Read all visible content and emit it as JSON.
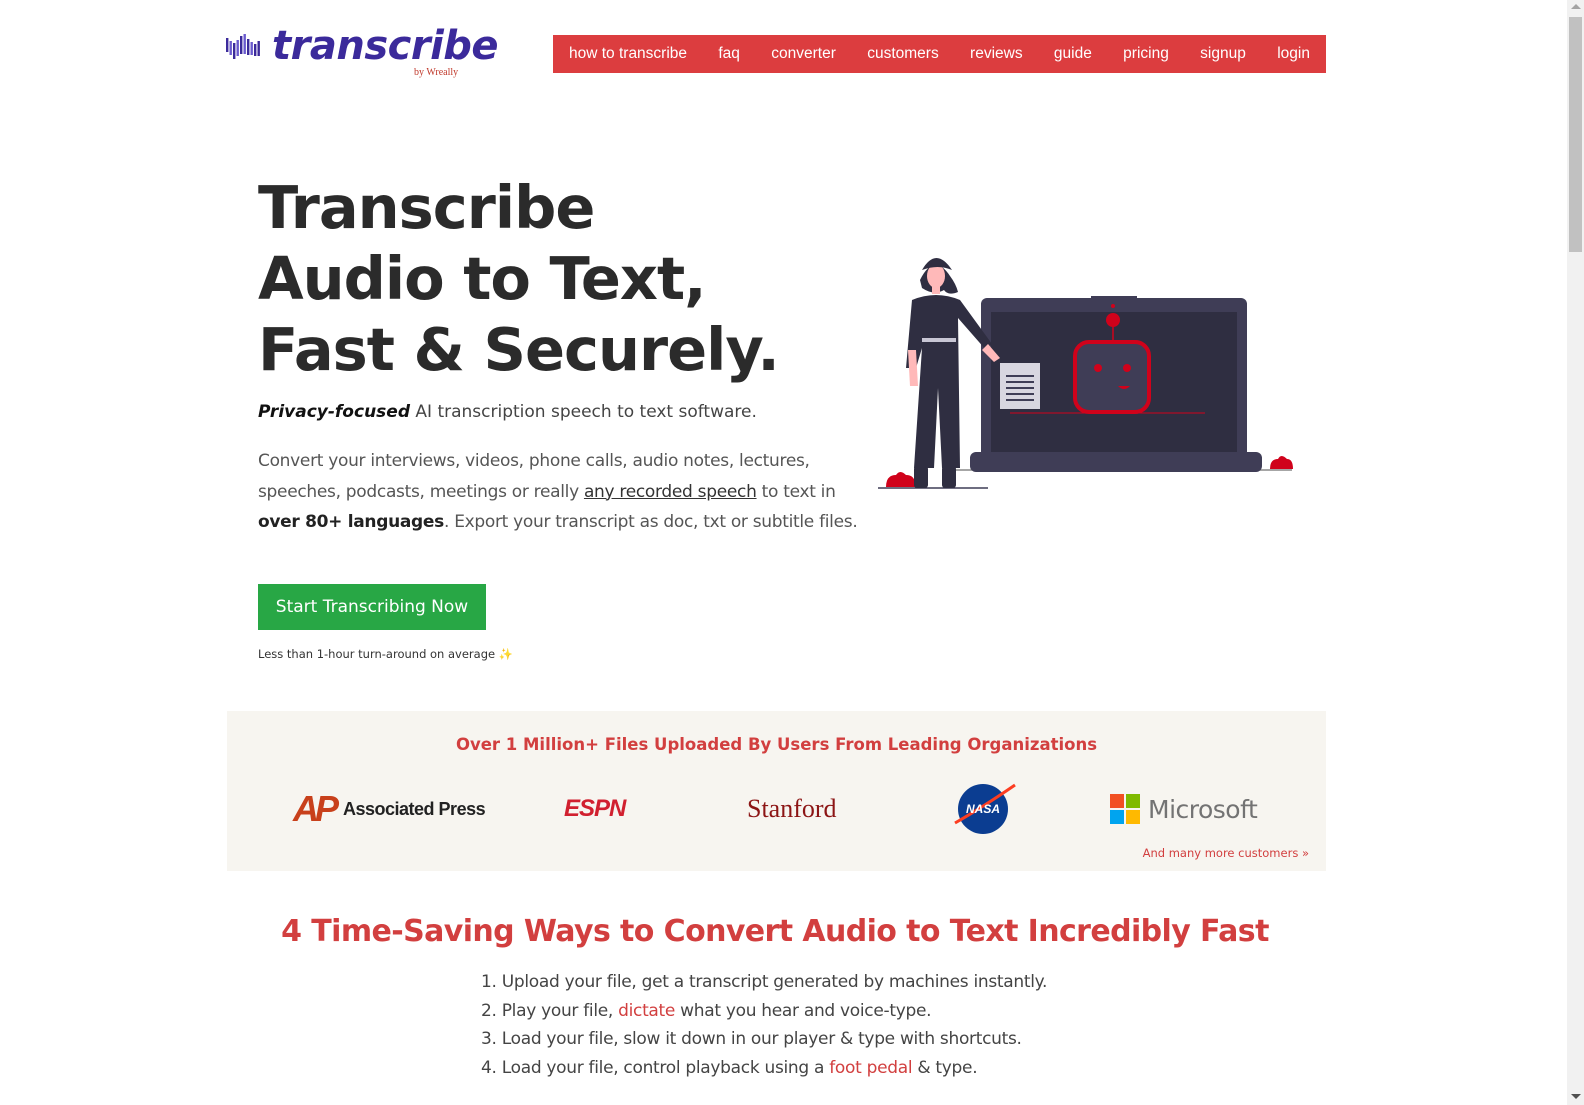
{
  "brand": {
    "name": "transcribe",
    "byline": "by Wreally",
    "color": "#3b2a9b",
    "logo_icon": "sound-wave-icon"
  },
  "nav": {
    "color": "#dc3d3f",
    "items": [
      {
        "label": "how to transcribe"
      },
      {
        "label": "faq"
      },
      {
        "label": "converter"
      },
      {
        "label": "customers"
      },
      {
        "label": "reviews"
      },
      {
        "label": "guide"
      },
      {
        "label": "pricing"
      },
      {
        "label": "signup"
      },
      {
        "label": "login"
      }
    ]
  },
  "hero": {
    "title_lines": [
      "Transcribe",
      "Audio to Text,",
      "Fast & Securely."
    ],
    "tagline_emphasis": "Privacy-focused",
    "tagline_rest": " AI transcription speech to text software.",
    "desc_part1": "Convert your interviews, videos, phone calls, audio notes, lectures, speeches, podcasts, meetings or really ",
    "desc_link": "any recorded speech",
    "desc_part2": " to text in ",
    "desc_bold": "over 80+ languages",
    "desc_part3": ". Export your transcript as doc, txt or subtitle files.",
    "cta_label": "Start Transcribing Now",
    "cta_color": "#28a745",
    "turnaround": "Less than 1-hour turn-around on average",
    "turnaround_icon": "✨",
    "illustration": "woman-presenting-robot-laptop-illustration"
  },
  "customers": {
    "title": "Over 1 Million+ Files Uploaded By Users From Leading Organizations",
    "logos": {
      "ap_mark": "AP",
      "ap_text": "Associated Press",
      "espn": "ESPN",
      "stanford": "Stanford",
      "nasa": "NASA",
      "microsoft": "Microsoft"
    },
    "more_link": "And many more customers »"
  },
  "ways": {
    "title": "4 Time-Saving Ways to Convert Audio to Text Incredibly Fast",
    "items": [
      {
        "prefix": "1. Upload your file, get a transcript generated by machines instantly.",
        "link": "",
        "suffix": ""
      },
      {
        "prefix": "2. Play your file, ",
        "link": "dictate",
        "suffix": " what you hear and voice-type."
      },
      {
        "prefix": "3. Load your file, slow it down in our player & type with shortcuts.",
        "link": "",
        "suffix": ""
      },
      {
        "prefix": "4. Load your file, control playback using a ",
        "link": "foot pedal",
        "suffix": " & type."
      }
    ]
  }
}
